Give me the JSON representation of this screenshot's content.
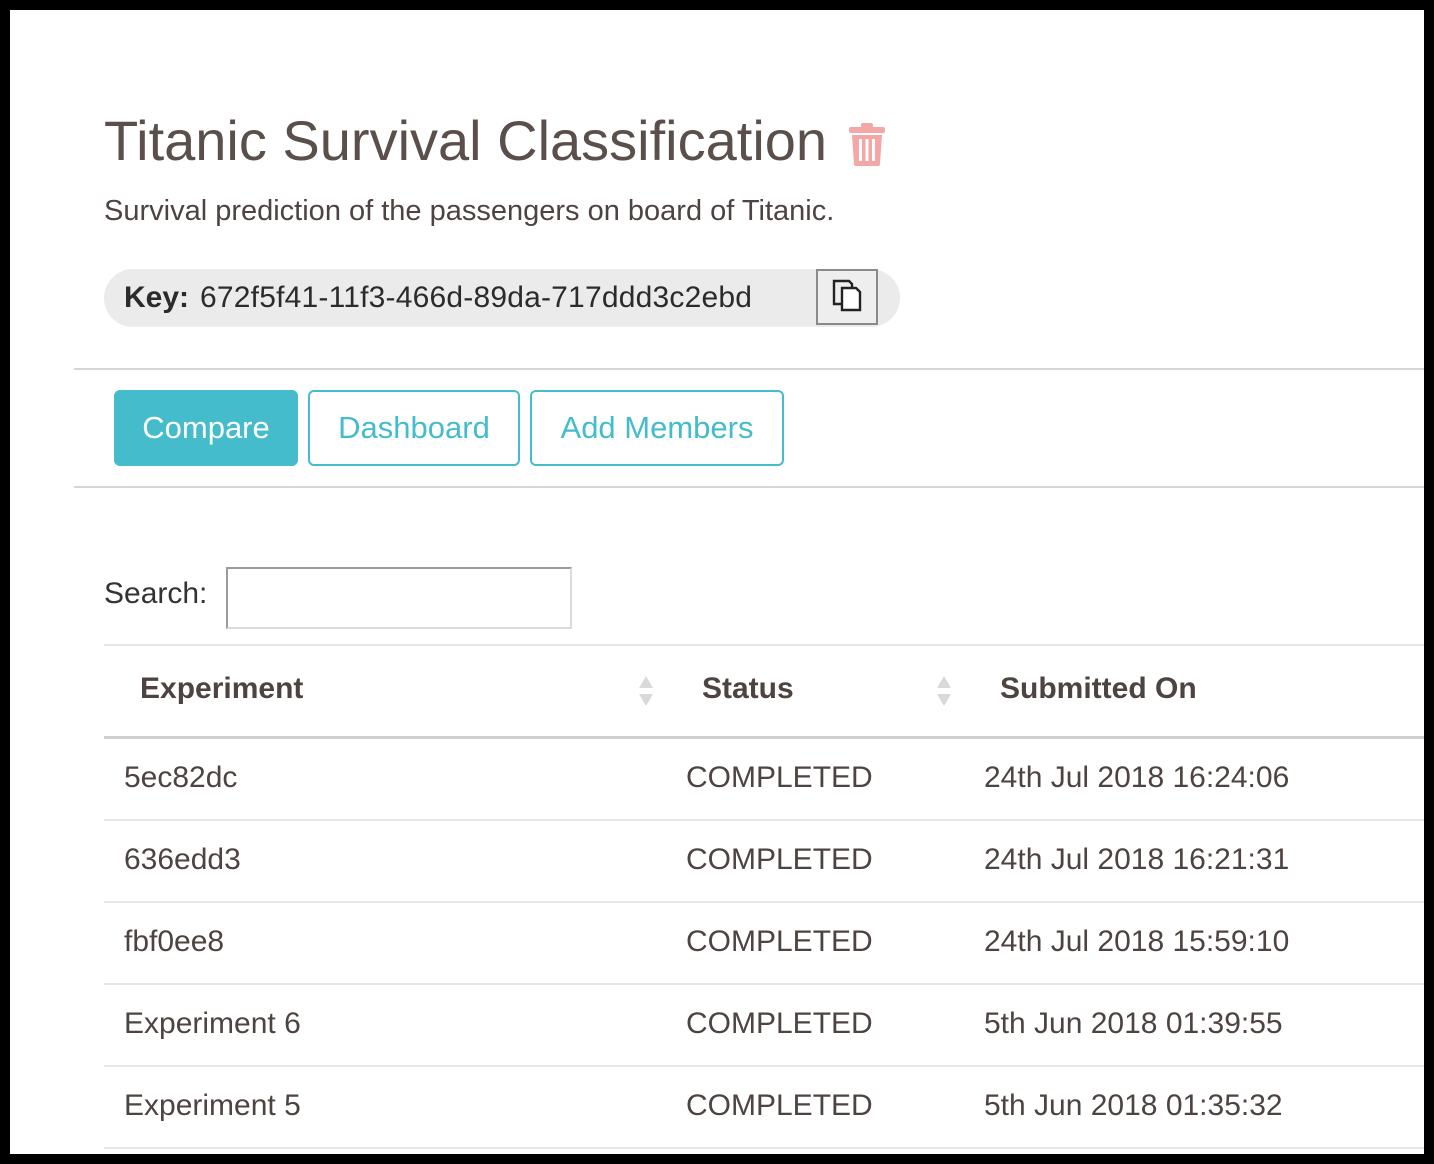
{
  "project": {
    "title": "Titanic Survival Classification",
    "description": "Survival prediction of the passengers on board of Titanic.",
    "key_label": "Key:",
    "key_value": "672f5f41-11f3-466d-89da-717ddd3c2ebd"
  },
  "icons": {
    "delete": "trash-icon",
    "copy": "copy-icon",
    "sort": "sort-icon"
  },
  "colors": {
    "accent": "#45bccb",
    "delete_icon": "#f3a7a7",
    "text": "#4d4341"
  },
  "actions": {
    "compare": "Compare",
    "dashboard": "Dashboard",
    "add_members": "Add Members"
  },
  "search": {
    "label": "Search:",
    "value": ""
  },
  "table": {
    "columns": [
      "Experiment",
      "Status",
      "Submitted On"
    ],
    "rows": [
      {
        "experiment": "5ec82dc",
        "status": "COMPLETED",
        "submitted_on": "24th Jul 2018 16:24:06"
      },
      {
        "experiment": "636edd3",
        "status": "COMPLETED",
        "submitted_on": "24th Jul 2018 16:21:31"
      },
      {
        "experiment": "fbf0ee8",
        "status": "COMPLETED",
        "submitted_on": "24th Jul 2018 15:59:10"
      },
      {
        "experiment": "Experiment 6",
        "status": "COMPLETED",
        "submitted_on": "5th Jun 2018 01:39:55"
      },
      {
        "experiment": "Experiment 5",
        "status": "COMPLETED",
        "submitted_on": "5th Jun 2018 01:35:32"
      }
    ]
  }
}
